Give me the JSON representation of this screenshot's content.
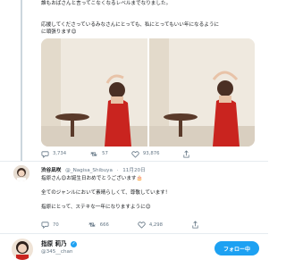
{
  "tweet": {
    "lines": [
      "誰もおばさんと言ってこなくなるレベルまでなりました。",
      "応援してくださっているみなさんにとっても、私にとってもいい年になるように",
      "に頑張ります😊"
    ],
    "stats": {
      "replies": "3,734",
      "retweets": "57",
      "likes": "93,876"
    }
  },
  "reply": {
    "name": "渋谷凪咲",
    "handle": "@_Nagisa_Shibuya",
    "date": "11月20日",
    "lines": [
      "指原さん😊お誕生日おめでとうございます🎂",
      "全てのジャンルにおいて素晴らしくて、尊敬しています！",
      "指原にとって、ステキな一年になりますように😊"
    ],
    "stats": {
      "replies": "70",
      "retweets": "666",
      "likes": "4,298"
    }
  },
  "author": {
    "name": "指原 莉乃",
    "handle": "@345__chan",
    "follow_label": "フォロー中"
  },
  "colors": {
    "accent": "#1da1f2",
    "dress": "#c9241f"
  }
}
